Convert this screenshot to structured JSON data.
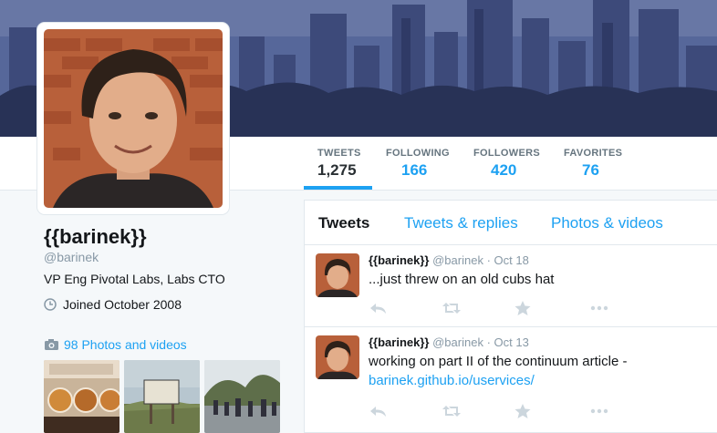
{
  "profile": {
    "name": "{{barinek}}",
    "handle": "@barinek",
    "bio": "VP Eng Pivotal Labs, Labs CTO",
    "joined": "Joined October 2008",
    "photos_label": "98 Photos and videos"
  },
  "stats": [
    {
      "label": "TWEETS",
      "value": "1,275"
    },
    {
      "label": "FOLLOWING",
      "value": "166"
    },
    {
      "label": "FOLLOWERS",
      "value": "420"
    },
    {
      "label": "FAVORITES",
      "value": "76"
    }
  ],
  "tabs": [
    "Tweets",
    "Tweets & replies",
    "Photos & videos"
  ],
  "tweets": [
    {
      "name": "{{barinek}}",
      "handle": "@barinek",
      "date": "Oct 18",
      "text": "...just threw on an old cubs hat",
      "link": ""
    },
    {
      "name": "{{barinek}}",
      "handle": "@barinek",
      "date": "Oct 13",
      "text": "working on part II of the continuum article -",
      "link": "barinek.github.io/uservices/"
    }
  ],
  "separator": "·",
  "icons": {
    "reply": "reply-icon",
    "retweet": "retweet-icon",
    "favorite": "star-icon",
    "more": "more-icon",
    "clock": "clock-icon",
    "camera": "camera-icon"
  },
  "colors": {
    "accent": "#1da1f2",
    "text": "#14171a",
    "muted": "#8899a6",
    "background": "#f5f8fa"
  }
}
